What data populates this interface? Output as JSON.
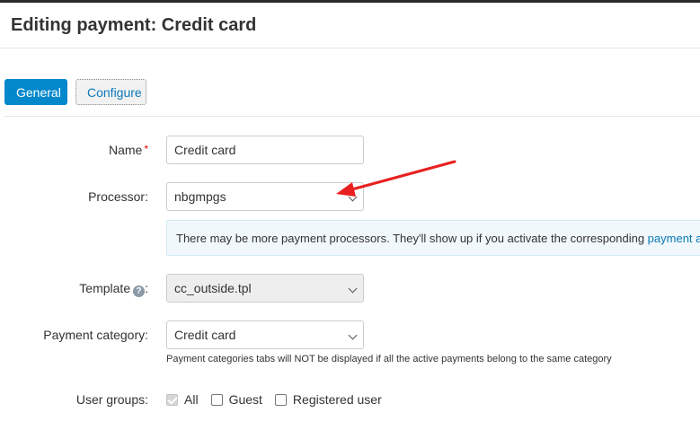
{
  "header": {
    "title": "Editing payment: Credit card"
  },
  "tabs": [
    {
      "label": "General",
      "active": true
    },
    {
      "label": "Configure",
      "active": false
    }
  ],
  "form": {
    "name": {
      "label": "Name",
      "required_mark": "*",
      "value": "Credit card"
    },
    "processor": {
      "label": "Processor:",
      "value": "nbgmpgs"
    },
    "info": {
      "text": "There may be more payment processors. They'll show up if you activate the corresponding ",
      "link": "payment a"
    },
    "template": {
      "label": "Template",
      "help_icon": "question-circle-icon",
      "colon": ":",
      "value": "cc_outside.tpl",
      "disabled": true
    },
    "payment_category": {
      "label": "Payment category:",
      "value": "Credit card",
      "hint": "Payment categories tabs will NOT be displayed if all the active payments belong to the same category"
    },
    "user_groups": {
      "label": "User groups:",
      "options": [
        {
          "label": "All",
          "checked": true,
          "disabled": true
        },
        {
          "label": "Guest",
          "checked": false
        },
        {
          "label": "Registered user",
          "checked": false
        }
      ]
    }
  },
  "colors": {
    "primary": "#0388cc",
    "link": "#0a78b8",
    "annotation_arrow": "#e8201f",
    "required": "#dd0000"
  }
}
